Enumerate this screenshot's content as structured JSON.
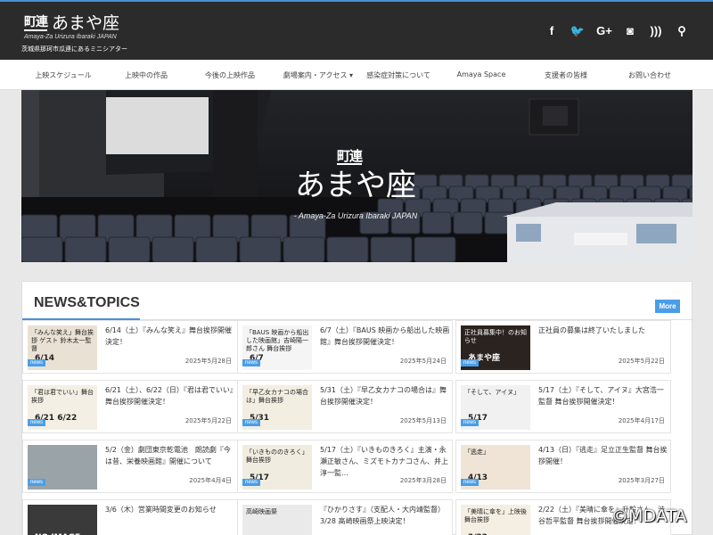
{
  "header": {
    "logo_mark": "町連",
    "title": "あまや座",
    "subtitle": "Amaya-Za Urizura Ibaraki JAPAN",
    "tagline": "茨城県那珂市瓜連にあるミニシアター",
    "social_icons": [
      {
        "name": "facebook-icon",
        "glyph": "f"
      },
      {
        "name": "twitter-icon",
        "glyph": "🐦"
      },
      {
        "name": "google-plus-icon",
        "glyph": "G+"
      },
      {
        "name": "instagram-icon",
        "glyph": "◙"
      },
      {
        "name": "rss-icon",
        "glyph": ")))"
      },
      {
        "name": "search-icon",
        "glyph": "⚲"
      }
    ]
  },
  "nav": {
    "items": [
      {
        "label": "上映スケジュール"
      },
      {
        "label": "上映中の作品"
      },
      {
        "label": "今後の上映作品"
      },
      {
        "label": "劇場案内・アクセス ▾"
      },
      {
        "label": "感染症対策について"
      },
      {
        "label": "Amaya Space"
      },
      {
        "label": "支援者の皆様"
      },
      {
        "label": "お問い合わせ"
      }
    ]
  },
  "hero": {
    "mark": "町連",
    "title": "あまや座",
    "subtitle": "- Amaya-Za Urizura Ibaraki JAPAN"
  },
  "news": {
    "title": "NEWS&TOPICS",
    "more_label": "More",
    "badge_label": "news",
    "cards": [
      {
        "title": "6/14（土）『みんな笑え』舞台挨拶開催決定！",
        "date": "2025年5月28日",
        "thumb_text": "「みんな笑え」舞台挨拶 ゲスト 鈴木太一監督",
        "thumb_big": "6/14",
        "thumb_bg": "#e9e2d4",
        "thumb_fg": "#222"
      },
      {
        "title": "6/7（土）『BAUS 映画から船出した映画館』舞台挨拶開催決定！",
        "date": "2025年5月24日",
        "thumb_text": "「BAUS 映画から船出した映画館」吉崎陽一郎さん 舞台挨拶",
        "thumb_big": "6/7",
        "thumb_bg": "#f5f5f5",
        "thumb_fg": "#222"
      },
      {
        "title": "正社員の募集は終了いたしました",
        "date": "2025年5月22日",
        "thumb_text": "正社員募集中！のお知らせ",
        "thumb_big": "あまや座",
        "thumb_bg": "#2a2320",
        "thumb_fg": "#fff"
      },
      {
        "title": "6/21（土）、6/22（日）『君は君でいい』舞台挨拶開催決定！",
        "date": "2025年5月22日",
        "thumb_text": "「君は君でいい」舞台挨拶",
        "thumb_big": "6/21 6/22",
        "thumb_bg": "#f4efe4",
        "thumb_fg": "#222"
      },
      {
        "title": "5/31（土）『早乙女カナコの場合は』舞台挨拶開催決定！",
        "date": "2025年5月13日",
        "thumb_text": "「早乙女カナコの場合は」舞台挨拶",
        "thumb_big": "5/31",
        "thumb_bg": "#f3eee2",
        "thumb_fg": "#222"
      },
      {
        "title": "5/17（土）『そして、アイヌ』大宮浩一監督 舞台挨拶開催決定！",
        "date": "2025年4月17日",
        "thumb_text": "「そして、アイヌ」",
        "thumb_big": "5/17",
        "thumb_bg": "#f1f1f1",
        "thumb_fg": "#222"
      },
      {
        "title": "5/2（金）劇団東京乾電池　朗読劇『今は昔、栄養映画館』開催について",
        "date": "2025年4月4日",
        "thumb_text": "",
        "thumb_big": "",
        "thumb_bg": "#9aa3a8",
        "thumb_fg": "#fff"
      },
      {
        "title": "5/17（土）『いきものきろく』主演・永瀬正敏さん、ミズモトカナコさん、井上淳一監…",
        "date": "2025年3月28日",
        "thumb_text": "「いきもののきろく」舞台挨拶",
        "thumb_big": "5/17",
        "thumb_bg": "#f1ece0",
        "thumb_fg": "#222"
      },
      {
        "title": "4/13（日）『逃走』足立正生監督 舞台挨拶開催！",
        "date": "2025年3月27日",
        "thumb_text": "「逃走」",
        "thumb_big": "4/13",
        "thumb_bg": "#efe4d6",
        "thumb_fg": "#222"
      },
      {
        "title": "3/6（木）営業時間変更のお知らせ",
        "date": "",
        "thumb_text": "",
        "thumb_big": "NO IMAGE",
        "thumb_bg": "#3a3a3a",
        "thumb_fg": "#fff"
      },
      {
        "title": "『ひかりさす』（支配人・大内靖監督）3/28 高崎映画祭上映決定！",
        "date": "",
        "thumb_text": "高崎映画祭",
        "thumb_big": "",
        "thumb_bg": "#eaeaea",
        "thumb_fg": "#222"
      },
      {
        "title": "2/22（土）『美晴に傘を』升毅さん、渋谷哲平監督 舞台挨拶開催決定！",
        "date": "",
        "thumb_text": "「美晴に傘を」上映後舞台挨拶",
        "thumb_big": "2/22",
        "thumb_bg": "#f5efe3",
        "thumb_fg": "#222"
      }
    ]
  },
  "watermark": "©MDATA"
}
